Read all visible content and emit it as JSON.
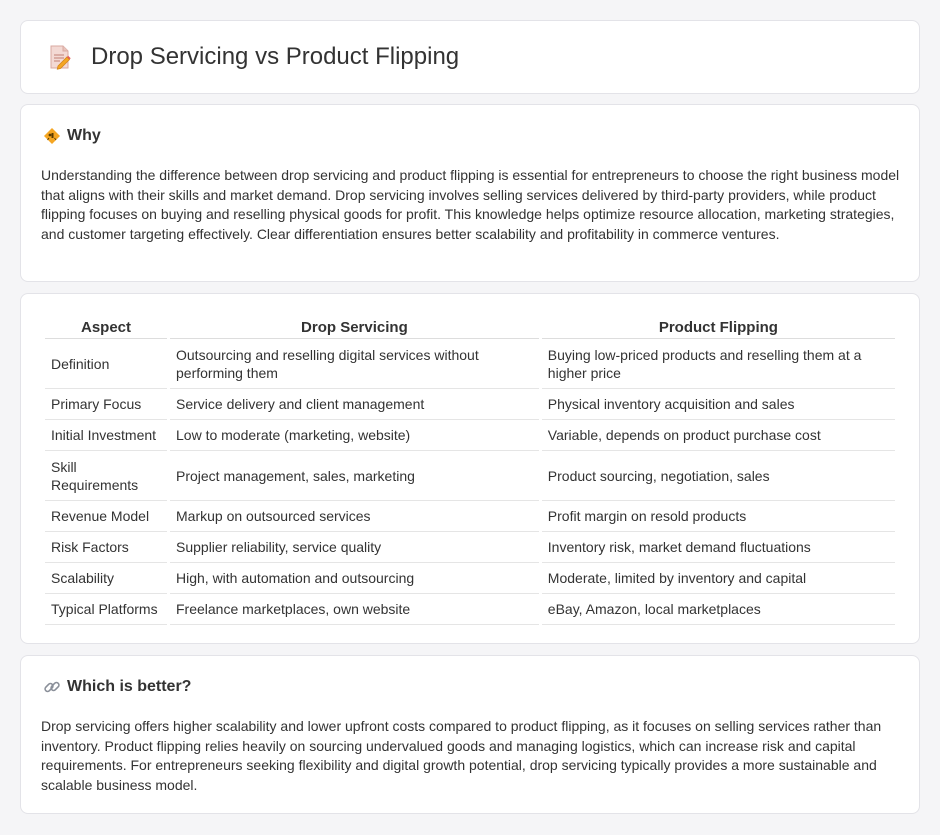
{
  "page": {
    "title": "Drop Servicing vs Product Flipping"
  },
  "why": {
    "heading": "Why",
    "text": "Understanding the difference between drop servicing and product flipping is essential for entrepreneurs to choose the right business model that aligns with their skills and market demand. Drop servicing involves selling services delivered by third-party providers, while product flipping focuses on buying and reselling physical goods for profit. This knowledge helps optimize resource allocation, marketing strategies, and customer targeting effectively. Clear differentiation ensures better scalability and profitability in commerce ventures."
  },
  "table": {
    "headers": [
      "Aspect",
      "Drop Servicing",
      "Product Flipping"
    ],
    "rows": [
      [
        "Definition",
        "Outsourcing and reselling digital services without performing them",
        "Buying low-priced products and reselling them at a higher price"
      ],
      [
        "Primary Focus",
        "Service delivery and client management",
        "Physical inventory acquisition and sales"
      ],
      [
        "Initial Investment",
        "Low to moderate (marketing, website)",
        "Variable, depends on product purchase cost"
      ],
      [
        "Skill Requirements",
        "Project management, sales, marketing",
        "Product sourcing, negotiation, sales"
      ],
      [
        "Revenue Model",
        "Markup on outsourced services",
        "Profit margin on resold products"
      ],
      [
        "Risk Factors",
        "Supplier reliability, service quality",
        "Inventory risk, market demand fluctuations"
      ],
      [
        "Scalability",
        "High, with automation and outsourcing",
        "Moderate, limited by inventory and capital"
      ],
      [
        "Typical Platforms",
        "Freelance marketplaces, own website",
        "eBay, Amazon, local marketplaces"
      ]
    ]
  },
  "better": {
    "heading": "Which is better?",
    "text": "Drop servicing offers higher scalability and lower upfront costs compared to product flipping, as it focuses on selling services rather than inventory. Product flipping relies heavily on sourcing undervalued goods and managing logistics, which can increase risk and capital requirements. For entrepreneurs seeking flexibility and digital growth potential, drop servicing typically provides a more sustainable and scalable business model."
  },
  "icons": {
    "title_icon": "document-pencil-icon",
    "why_icon": "diamond-sign-icon",
    "better_icon": "link-icon"
  },
  "colors": {
    "background": "#f5f5f7",
    "card": "#ffffff",
    "text": "#333333",
    "accent_orange": "#f5a623"
  }
}
